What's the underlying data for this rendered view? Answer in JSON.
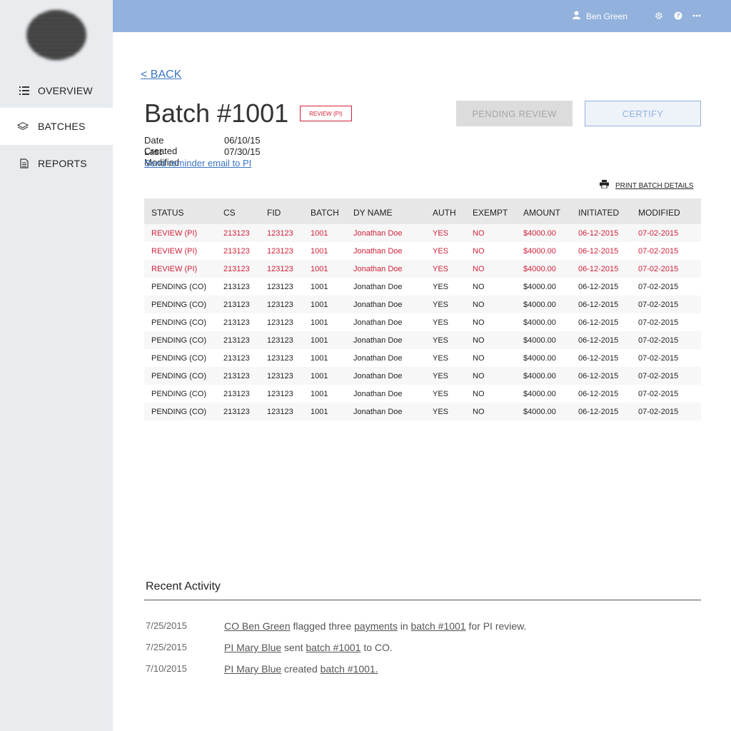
{
  "sidebar": {
    "items": [
      {
        "label": "OVERVIEW",
        "icon": "list-icon"
      },
      {
        "label": "BATCHES",
        "icon": "layers-icon"
      },
      {
        "label": "REPORTS",
        "icon": "document-icon"
      }
    ]
  },
  "topbar": {
    "user_name": "Ben Green",
    "icons": [
      "user-icon",
      "gear-icon",
      "help-icon",
      "more-icon"
    ]
  },
  "page": {
    "back_label": "< BACK",
    "title": "Batch #1001",
    "status_badge": "REVIEW (PI)",
    "pending_review_label": "PENDING REVIEW",
    "certify_label": "CERTIFY",
    "date_created_label": "Date Created",
    "date_created_value": "06/10/15",
    "last_modified_label": "Last Modified",
    "last_modified_value": "07/30/15",
    "reminder_link": "Send reminder email to PI",
    "print_label": "PRINT BATCH DETAILS"
  },
  "table": {
    "headers": [
      "STATUS",
      "CS",
      "FID",
      "BATCH",
      "DY NAME",
      "AUTH",
      "EXEMPT",
      "AMOUNT",
      "INITIATED",
      "MODIFIED"
    ],
    "rows": [
      {
        "flagged": true,
        "cells": [
          "REVIEW (PI)",
          "213123",
          "123123",
          "1001",
          "Jonathan Doe",
          "YES",
          "NO",
          "$4000.00",
          "06-12-2015",
          "07-02-2015"
        ]
      },
      {
        "flagged": true,
        "cells": [
          "REVIEW (PI)",
          "213123",
          "123123",
          "1001",
          "Jonathan Doe",
          "YES",
          "NO",
          "$4000.00",
          "06-12-2015",
          "07-02-2015"
        ]
      },
      {
        "flagged": true,
        "cells": [
          "REVIEW (PI)",
          "213123",
          "123123",
          "1001",
          "Jonathan Doe",
          "YES",
          "NO",
          "$4000.00",
          "06-12-2015",
          "07-02-2015"
        ]
      },
      {
        "flagged": false,
        "cells": [
          "PENDING (CO)",
          "213123",
          "123123",
          "1001",
          "Jonathan Doe",
          "YES",
          "NO",
          "$4000.00",
          "06-12-2015",
          "07-02-2015"
        ]
      },
      {
        "flagged": false,
        "cells": [
          "PENDING (CO)",
          "213123",
          "123123",
          "1001",
          "Jonathan Doe",
          "YES",
          "NO",
          "$4000.00",
          "06-12-2015",
          "07-02-2015"
        ]
      },
      {
        "flagged": false,
        "cells": [
          "PENDING (CO)",
          "213123",
          "123123",
          "1001",
          "Jonathan Doe",
          "YES",
          "NO",
          "$4000.00",
          "06-12-2015",
          "07-02-2015"
        ]
      },
      {
        "flagged": false,
        "cells": [
          "PENDING (CO)",
          "213123",
          "123123",
          "1001",
          "Jonathan Doe",
          "YES",
          "NO",
          "$4000.00",
          "06-12-2015",
          "07-02-2015"
        ]
      },
      {
        "flagged": false,
        "cells": [
          "PENDING (CO)",
          "213123",
          "123123",
          "1001",
          "Jonathan Doe",
          "YES",
          "NO",
          "$4000.00",
          "06-12-2015",
          "07-02-2015"
        ]
      },
      {
        "flagged": false,
        "cells": [
          "PENDING (CO)",
          "213123",
          "123123",
          "1001",
          "Jonathan Doe",
          "YES",
          "NO",
          "$4000.00",
          "06-12-2015",
          "07-02-2015"
        ]
      },
      {
        "flagged": false,
        "cells": [
          "PENDING (CO)",
          "213123",
          "123123",
          "1001",
          "Jonathan Doe",
          "YES",
          "NO",
          "$4000.00",
          "06-12-2015",
          "07-02-2015"
        ]
      },
      {
        "flagged": false,
        "cells": [
          "PENDING (CO)",
          "213123",
          "123123",
          "1001",
          "Jonathan Doe",
          "YES",
          "NO",
          "$4000.00",
          "06-12-2015",
          "07-02-2015"
        ]
      }
    ]
  },
  "activity": {
    "title": "Recent Activity",
    "items": [
      {
        "date": "7/25/2015",
        "actor": "CO Ben Green",
        "t1": " flagged three ",
        "l1": "payments",
        "t2": " in ",
        "l2": "batch #1001",
        "t3": " for PI review."
      },
      {
        "date": "7/25/2015",
        "actor": "PI Mary Blue",
        "t1": " sent ",
        "l1": "batch #1001",
        "t2": " to CO.",
        "l2": "",
        "t3": ""
      },
      {
        "date": "7/10/2015",
        "actor": "PI Mary Blue",
        "t1": " created ",
        "l1": "batch #1001.",
        "t2": "",
        "l2": "",
        "t3": ""
      }
    ]
  },
  "colors": {
    "topbar": "#92b1dc",
    "sidebar": "#e9ecef",
    "flagged_text": "#d0213a",
    "link": "#3a75c4"
  }
}
